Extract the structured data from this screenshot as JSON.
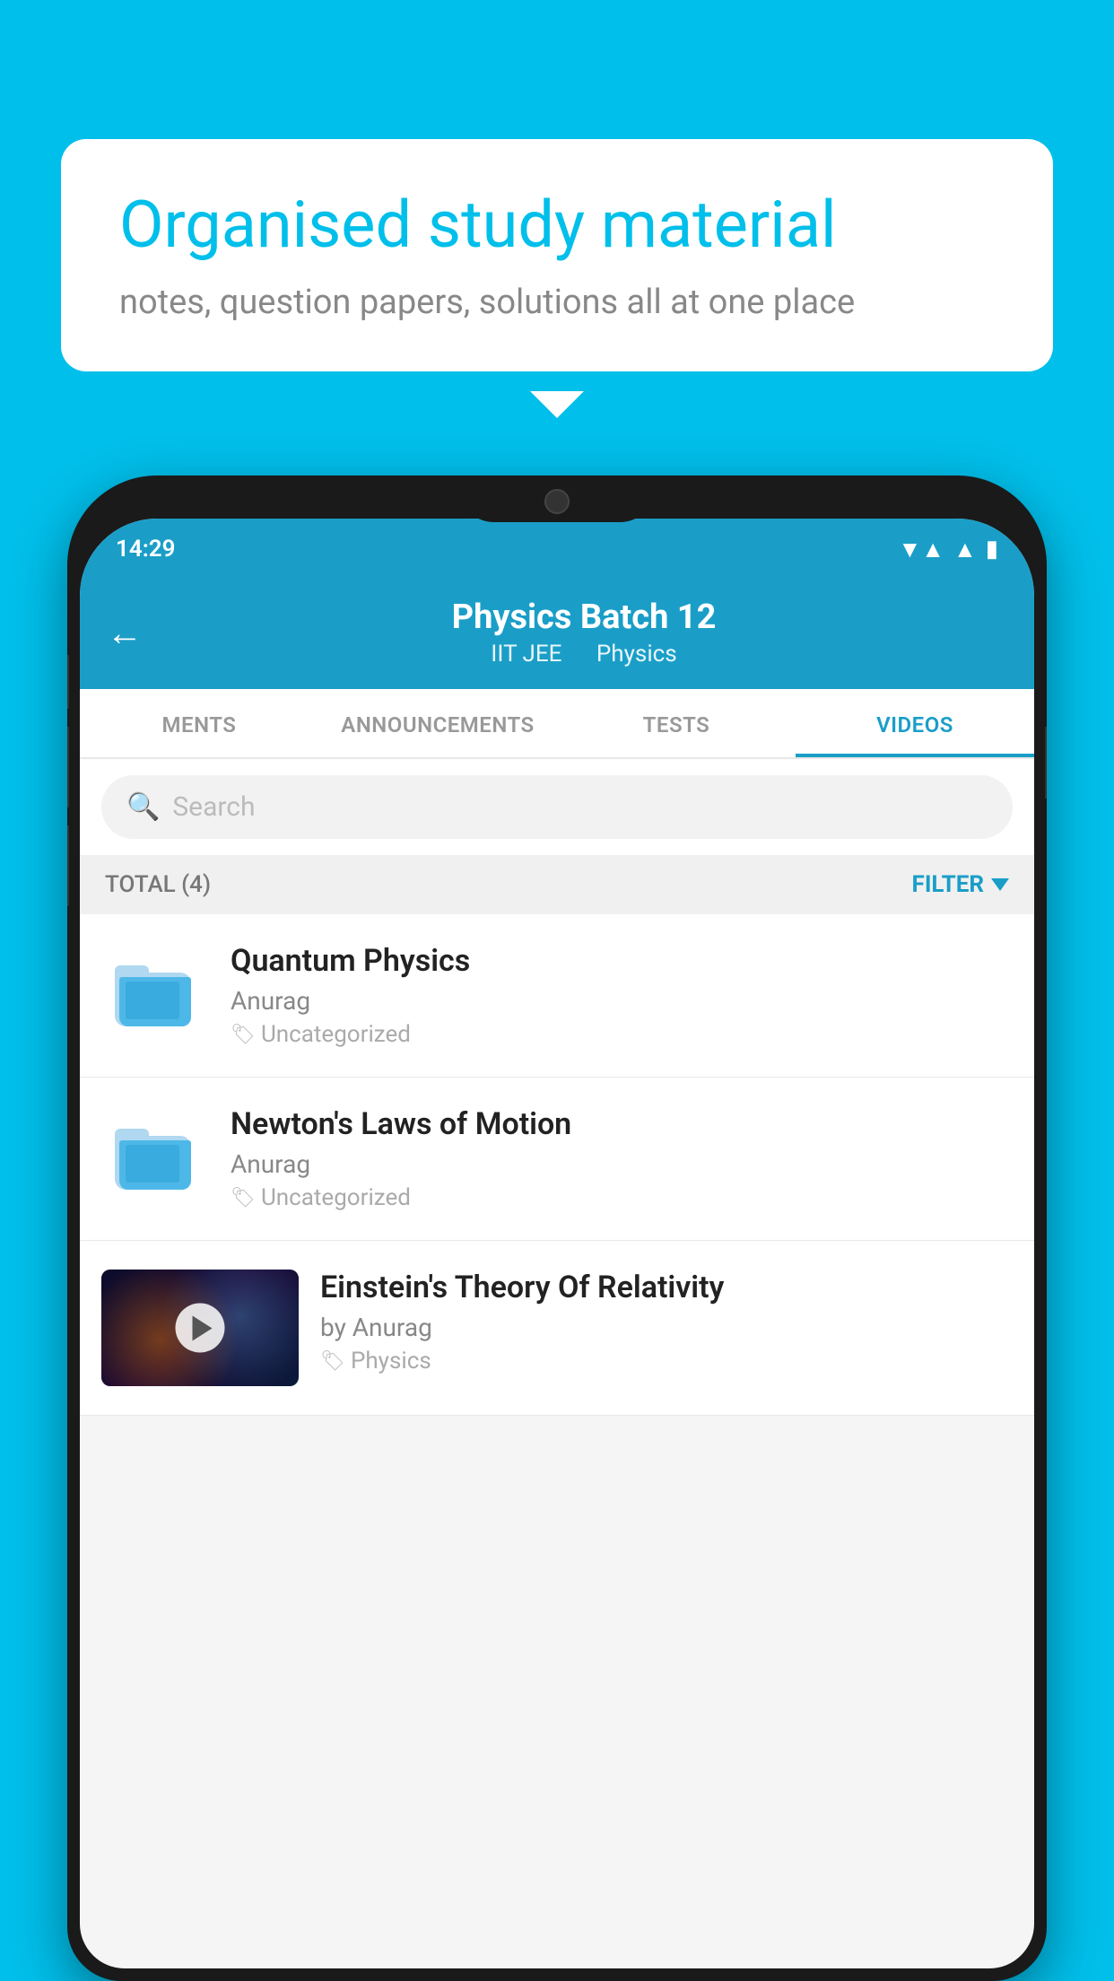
{
  "background_color": "#00BFEA",
  "speech_bubble": {
    "title": "Organised study material",
    "subtitle": "notes, question papers, solutions all at one place"
  },
  "phone": {
    "status_bar": {
      "time": "14:29"
    },
    "header": {
      "title": "Physics Batch 12",
      "subtitle_part1": "IIT JEE",
      "subtitle_part2": "Physics",
      "back_label": "←"
    },
    "tabs": [
      {
        "label": "MENTS",
        "active": false
      },
      {
        "label": "ANNOUNCEMENTS",
        "active": false
      },
      {
        "label": "TESTS",
        "active": false
      },
      {
        "label": "VIDEOS",
        "active": true
      }
    ],
    "search": {
      "placeholder": "Search"
    },
    "filter": {
      "total_label": "TOTAL (4)",
      "filter_label": "FILTER"
    },
    "videos": [
      {
        "title": "Quantum Physics",
        "author": "Anurag",
        "tag": "Uncategorized",
        "type": "folder"
      },
      {
        "title": "Newton's Laws of Motion",
        "author": "Anurag",
        "tag": "Uncategorized",
        "type": "folder"
      },
      {
        "title": "Einstein's Theory Of Relativity",
        "author": "by Anurag",
        "tag": "Physics",
        "type": "video"
      }
    ]
  }
}
